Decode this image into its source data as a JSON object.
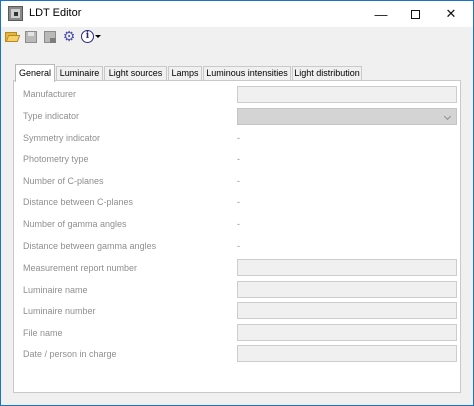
{
  "window": {
    "title": "LDT Editor",
    "controls": {
      "minimize": "—",
      "close": "✕"
    }
  },
  "toolbar": {
    "icons": [
      "folder-open-icon",
      "save-icon",
      "save-as-icon",
      "settings-gear-icon",
      "info-icon"
    ],
    "info_glyph": "i"
  },
  "tabs": [
    {
      "label": "General",
      "active": true
    },
    {
      "label": "Luminaire",
      "active": false
    },
    {
      "label": "Light sources",
      "active": false
    },
    {
      "label": "Lamps",
      "active": false
    },
    {
      "label": "Luminous intensities",
      "active": false
    },
    {
      "label": "Light distribution",
      "active": false
    }
  ],
  "general": {
    "fields": [
      {
        "label": "Manufacturer",
        "kind": "input",
        "value": ""
      },
      {
        "label": "Type indicator",
        "kind": "select",
        "value": ""
      },
      {
        "label": "Symmetry indicator",
        "kind": "readonly",
        "value": "-"
      },
      {
        "label": "Photometry type",
        "kind": "readonly",
        "value": "-"
      },
      {
        "label": "Number of C-planes",
        "kind": "readonly",
        "value": "-"
      },
      {
        "label": "Distance between C-planes",
        "kind": "readonly",
        "value": "-"
      },
      {
        "label": "Number of gamma angles",
        "kind": "readonly",
        "value": "-"
      },
      {
        "label": "Distance between gamma angles",
        "kind": "readonly",
        "value": "-"
      },
      {
        "label": "Measurement report number",
        "kind": "input",
        "value": ""
      },
      {
        "label": "Luminaire name",
        "kind": "input",
        "value": ""
      },
      {
        "label": "Luminaire number",
        "kind": "input",
        "value": ""
      },
      {
        "label": "File name",
        "kind": "input",
        "value": ""
      },
      {
        "label": "Date / person in charge",
        "kind": "input",
        "value": ""
      }
    ]
  },
  "colors": {
    "window_border": "#1a73c8",
    "label_disabled": "#8f8f8f",
    "field_disabled": "#f0f0f0"
  }
}
